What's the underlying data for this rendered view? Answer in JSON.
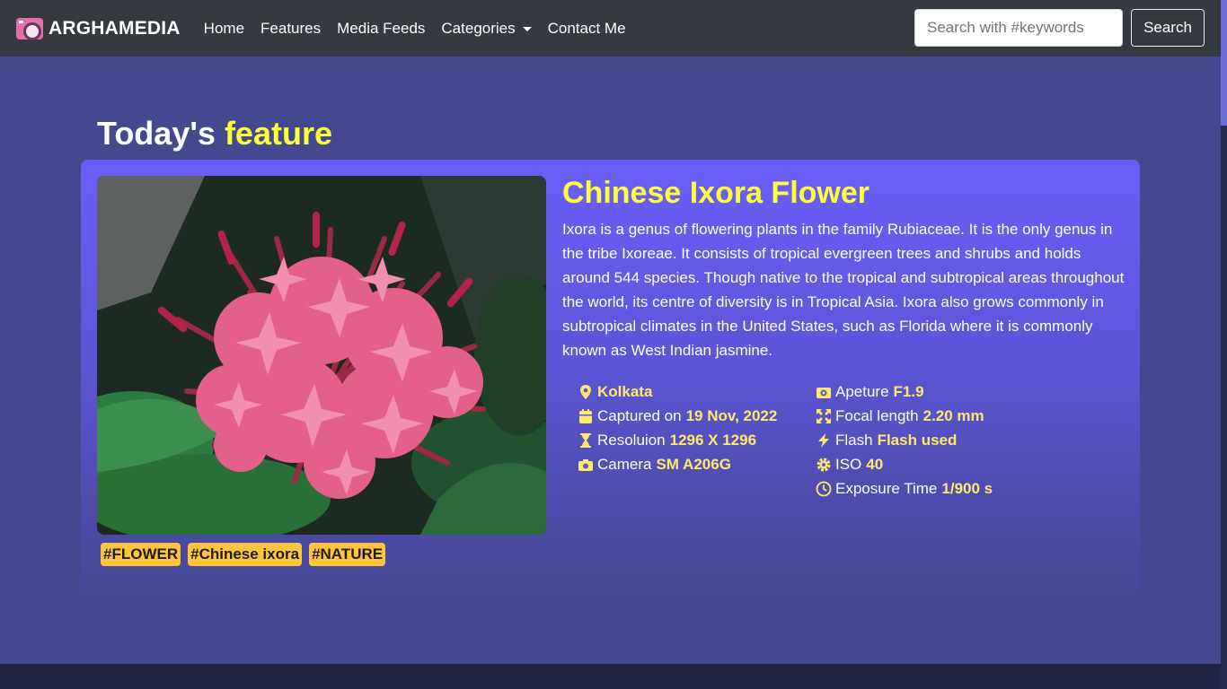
{
  "navbar": {
    "brand": "ARGHAMEDIA",
    "links": [
      "Home",
      "Features",
      "Media Feeds",
      "Categories",
      "Contact Me"
    ],
    "search_placeholder": "Search with #keywords",
    "search_button": "Search"
  },
  "heading": {
    "prefix": "Today's ",
    "accent": "feature"
  },
  "feature": {
    "title": "Chinese Ixora Flower",
    "description": "Ixora is a genus of flowering plants in the family Rubiaceae. It is the only genus in the tribe Ixoreae. It consists of tropical evergreen trees and shrubs and holds around 544 species. Though native to the tropical and subtropical areas throughout the world, its centre of diversity is in Tropical Asia. Ixora also grows commonly in subtropical climates in the United States, such as Florida where it is commonly known as West Indian jasmine.",
    "tags": [
      "#FLOWER",
      "#Chinese ixora",
      "#NATURE"
    ],
    "meta_left": [
      {
        "icon": "location-pin-icon",
        "label": "",
        "value": "Kolkata"
      },
      {
        "icon": "calendar-icon",
        "label": "Captured on",
        "value": "19 Nov, 2022"
      },
      {
        "icon": "hourglass-icon",
        "label": "Resoluion",
        "value": "1296 X 1296"
      },
      {
        "icon": "camera-icon",
        "label": "Camera",
        "value": "SM A206G"
      }
    ],
    "meta_right": [
      {
        "icon": "aperture-camera-icon",
        "label": "Apeture",
        "value": "F1.9"
      },
      {
        "icon": "focal-arrows-icon",
        "label": "Focal length",
        "value": "2.20 mm"
      },
      {
        "icon": "bolt-icon",
        "label": "Flash",
        "value": "Flash used"
      },
      {
        "icon": "gear-icon",
        "label": "ISO",
        "value": "40"
      },
      {
        "icon": "clock-icon",
        "label": "Exposure Time",
        "value": "1/900 s"
      }
    ]
  },
  "colors": {
    "navbar": "#343a40",
    "page_bg": "#43488f",
    "card_top": "#6b5ef8",
    "accent_yellow": "#ffff3a",
    "tag_bg": "#ffc43d",
    "meta_value": "#ffe96b"
  }
}
